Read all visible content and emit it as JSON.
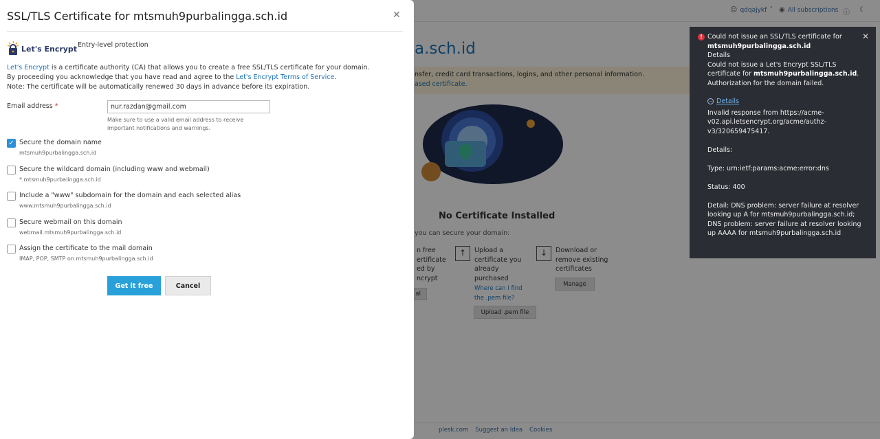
{
  "background": {
    "user_menu": "qdqajykf",
    "subscriptions_link": "All subscriptions",
    "domain_title": "a.sch.id",
    "warning_line1": "nsfer, credit card transactions, logins, and other personal information.",
    "warning_line2": "ased certificate.",
    "no_cert_title": "No Certificate Installed",
    "secure_prompt": "you can secure your domain:",
    "col1_text": "n free\nertificate\ned by\nncrypt",
    "col1_button": "al",
    "col2_text": "Upload a certificate you already purchased",
    "col2_link": "Where can I find the .pem file?",
    "col2_button": "Upload .pem file",
    "col3_text": "Download or remove existing certificates",
    "col3_button": "Manage",
    "footer_links": [
      "plesk.com",
      "Suggest an Idea",
      "Cookies"
    ]
  },
  "modal": {
    "title": "SSL/TLS Certificate for mtsmuh9purbalingga.sch.id",
    "provider_name": "Let's Encrypt",
    "provider_tagline": "Entry-level protection",
    "intro_link1": "Let's Encrypt",
    "intro_line1_rest": " is a certificate authority (CA) that allows you to create a free SSL/TLS certificate for your domain.",
    "intro_line2_start": "By proceeding you acknowledge that you have read and agree to the ",
    "intro_link2": "Let's Encrypt Terms of Service",
    "intro_line2_end": ".",
    "intro_line3": "Note: The certificate will be automatically renewed 30 days in advance before its expiration.",
    "email_label": "Email address",
    "email_required_mark": "*",
    "email_value": "nur.razdan@gmail.com",
    "email_hint": "Make sure to use a valid email address to receive important notifications and warnings.",
    "options": [
      {
        "label": "Secure the domain name",
        "sub": "mtsmuh9purbalingga.sch.id",
        "checked": true
      },
      {
        "label": "Secure the wildcard domain (including www and webmail)",
        "sub": "*.mtsmuh9purbalingga.sch.id",
        "checked": false
      },
      {
        "label": "Include a \"www\" subdomain for the domain and each selected alias",
        "sub": "www.mtsmuh9purbalingga.sch.id",
        "checked": false
      },
      {
        "label": "Secure webmail on this domain",
        "sub": "webmail.mtsmuh9purbalingga.sch.id",
        "checked": false
      },
      {
        "label": "Assign the certificate to the mail domain",
        "sub": "IMAP, POP, SMTP on mtsmuh9purbalingga.sch.id",
        "checked": false
      }
    ],
    "submit_label": "Get it free",
    "cancel_label": "Cancel"
  },
  "toast": {
    "heading_1": "Could not issue an SSL/TLS certificate for",
    "heading_domain": "mtsmuh9purbalingga.sch.id",
    "details_word": "Details",
    "msg_start": "Could not issue a Let's Encrypt SSL/TLS certificate for ",
    "msg_domain": "mtsmuh9purbalingga.sch.id",
    "msg_end": ". Authorization for the domain failed.",
    "details_link": "Details",
    "invalid_response": "Invalid response from https://acme-v02.api.letsencrypt.org/acme/authz-v3/320659475417.",
    "details_label": "Details:",
    "type_line": "Type: urn:ietf:params:acme:error:dns",
    "status_line": "Status: 400",
    "detail_line": "Detail: DNS problem: server failure at resolver looking up A for mtsmuh9purbalingga.sch.id; DNS problem: server failure at resolver looking up AAAA for mtsmuh9purbalingga.sch.id"
  },
  "colors": {
    "accent": "#28a0d9",
    "link": "#1d73b8",
    "toast_bg": "#2a2d33",
    "error": "#e0323c"
  }
}
